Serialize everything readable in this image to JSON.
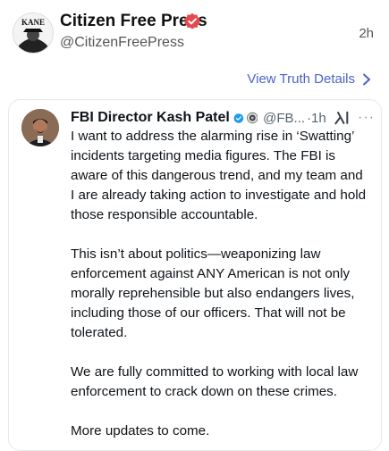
{
  "post": {
    "author_name": "Citizen Free Press",
    "handle": "@CitizenFreePress",
    "time": "2h",
    "avatar_text": "KANE",
    "view_link": "View Truth Details"
  },
  "embed": {
    "author_name": "FBI Director Kash Patel",
    "handle": "@FB...",
    "dot_time": "·1h",
    "more": "···",
    "paragraphs": [
      "I want to address the alarming rise in ‘Swatting’ incidents targeting media figures. The FBI is aware of this dangerous trend, and my team and I are already taking action to investigate and hold those responsible accountable.",
      "This isn’t about politics—weaponizing law enforcement against ANY  American is not only morally reprehensible but also endangers lives, including those of our officers. That will not be tolerated.",
      "We are fully committed to working with local law enforcement to crack down on these crimes.",
      "More updates to come."
    ]
  },
  "colors": {
    "link": "#4a64c8",
    "verified": "#e5484d",
    "x_verified": "#1d9bf0"
  },
  "icons": [
    "verified-badge-icon",
    "chevron-right-icon",
    "blue-check-icon",
    "fbi-seal-icon",
    "grok-logo-icon"
  ]
}
